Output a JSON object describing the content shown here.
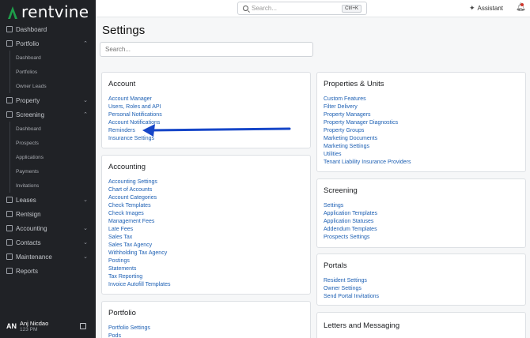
{
  "app": {
    "brand": "rentvine",
    "brand_color": "#1e9e4a",
    "link_color": "#1c5fb3"
  },
  "sidebar": {
    "items": [
      {
        "label": "Dashboard",
        "icon": "dashboard-icon",
        "type": "item"
      },
      {
        "label": "Portfolio",
        "icon": "portfolio-icon",
        "type": "item",
        "expanded": true
      },
      {
        "label": "Dashboard",
        "type": "sub"
      },
      {
        "label": "Portfolios",
        "type": "sub"
      },
      {
        "label": "Owner Leads",
        "type": "sub"
      },
      {
        "label": "Property",
        "icon": "property-icon",
        "type": "item",
        "expanded": false
      },
      {
        "label": "Screening",
        "icon": "screening-icon",
        "type": "item",
        "expanded": true
      },
      {
        "label": "Dashboard",
        "type": "sub"
      },
      {
        "label": "Prospects",
        "type": "sub"
      },
      {
        "label": "Applications",
        "type": "sub"
      },
      {
        "label": "Payments",
        "type": "sub"
      },
      {
        "label": "Invitations",
        "type": "sub"
      },
      {
        "label": "Leases",
        "icon": "leases-icon",
        "type": "item",
        "expanded": false
      },
      {
        "label": "Rentsign",
        "icon": "rentsign-icon",
        "type": "item"
      },
      {
        "label": "Accounting",
        "icon": "accounting-icon",
        "type": "item",
        "expanded": false
      },
      {
        "label": "Contacts",
        "icon": "contacts-icon",
        "type": "item",
        "expanded": false
      },
      {
        "label": "Maintenance",
        "icon": "maintenance-icon",
        "type": "item",
        "expanded": false
      },
      {
        "label": "Reports",
        "icon": "reports-icon",
        "type": "item"
      }
    ],
    "user": {
      "initials": "AN",
      "name": "Anj Nicdao",
      "sub": "123 PM"
    }
  },
  "topbar": {
    "search_placeholder": "Search...",
    "shortcut": "Ctrl+K",
    "assistant_label": "Assistant"
  },
  "main": {
    "title": "Settings",
    "search_placeholder": "Search...",
    "cards": {
      "account": {
        "title": "Account",
        "links": [
          "Account Manager",
          "Users, Roles and API",
          "Personal Notifications",
          "Account Notifications",
          "Reminders",
          "Insurance Settings"
        ]
      },
      "accounting": {
        "title": "Accounting",
        "links": [
          "Accounting Settings",
          "Chart of Accounts",
          "Account Categories",
          "Check Templates",
          "Check Images",
          "Management Fees",
          "Late Fees",
          "Sales Tax",
          "Sales Tax Agency",
          "Withholding Tax Agency",
          "Postings",
          "Statements",
          "Tax Reporting",
          "Invoice Autofill Templates"
        ]
      },
      "portfolio": {
        "title": "Portfolio",
        "links": [
          "Portfolio Settings",
          "Pods"
        ]
      },
      "property_units": {
        "title": "Properties & Units",
        "links": [
          "Custom Features",
          "Filter Delivery",
          "Property Managers",
          "Property Manager Diagnostics",
          "Property Groups",
          "Marketing Documents",
          "Marketing Settings",
          "Utilities",
          "Tenant Liability Insurance Providers"
        ]
      },
      "screening": {
        "title": "Screening",
        "links": [
          "Settings",
          "Application Templates",
          "Application Statuses",
          "Addendum Templates",
          "Prospects Settings"
        ]
      },
      "portals": {
        "title": "Portals",
        "links": [
          "Resident Settings",
          "Owner Settings",
          "Send Portal Invitations"
        ]
      },
      "letters": {
        "title": "Letters and Messaging",
        "links": []
      }
    }
  },
  "annotation": {
    "arrow_color": "#1646c8",
    "points_to": "Reminders"
  }
}
